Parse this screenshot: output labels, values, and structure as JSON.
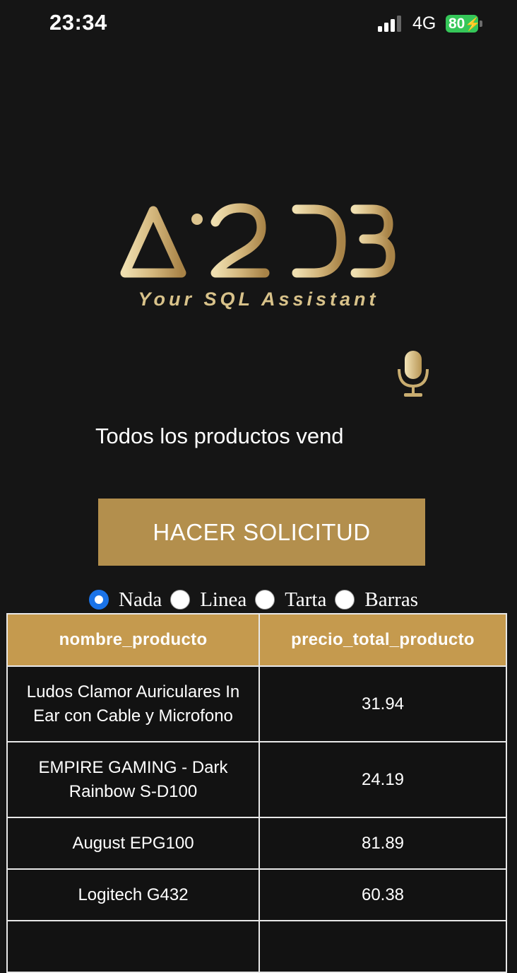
{
  "status_bar": {
    "time": "23:34",
    "network": "4G",
    "battery": "80"
  },
  "logo": {
    "wordmark": "Ai2DB",
    "tagline": "Your SQL Assistant"
  },
  "query": {
    "value": "Todos los productos vend"
  },
  "submit": {
    "label": "HACER SOLICITUD"
  },
  "chart_options": {
    "selected": "Nada",
    "items": [
      {
        "label": "Nada",
        "checked": true
      },
      {
        "label": "Linea",
        "checked": false
      },
      {
        "label": "Tarta",
        "checked": false
      },
      {
        "label": "Barras",
        "checked": false
      }
    ]
  },
  "table": {
    "headers": [
      "nombre_producto",
      "precio_total_producto"
    ],
    "rows": [
      [
        "Ludos Clamor Auriculares In Ear con Cable y Microfono",
        "31.94"
      ],
      [
        "EMPIRE GAMING - Dark Rainbow S-D100",
        "24.19"
      ],
      [
        "August EPG100",
        "81.89"
      ],
      [
        "Logitech G432",
        "60.38"
      ]
    ]
  },
  "colors": {
    "accent_gold": "#b38f4d",
    "header_gold": "#c59a4e",
    "background": "#151515",
    "radio_selected": "#1a73e8"
  }
}
